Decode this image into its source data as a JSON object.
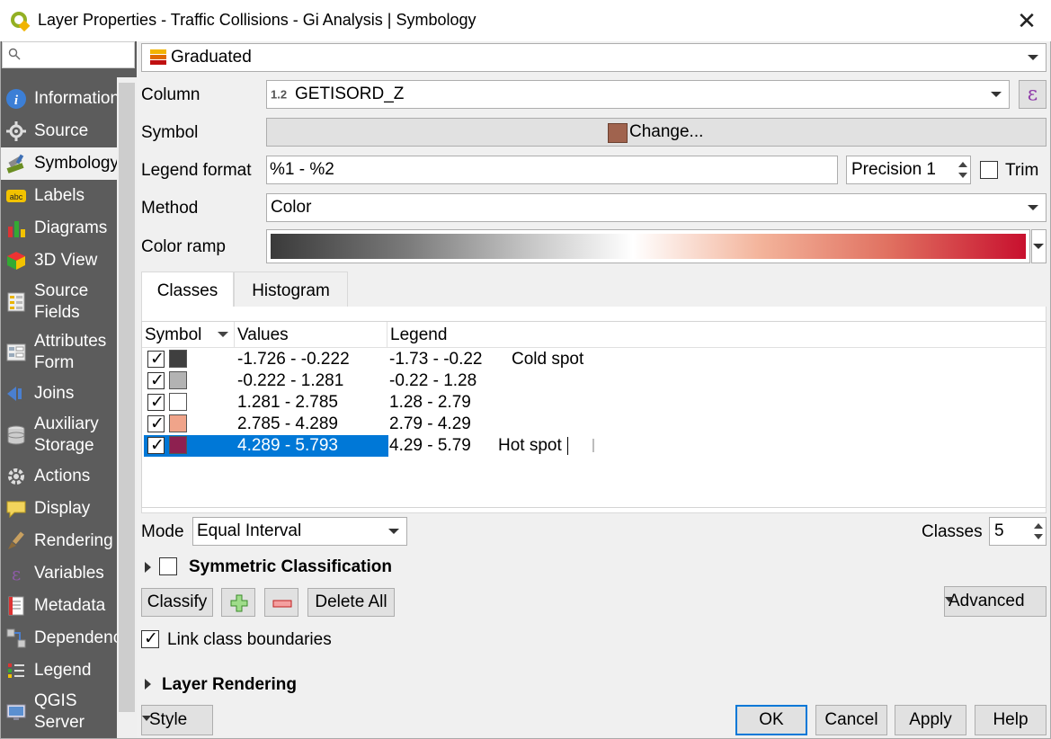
{
  "window": {
    "title": "Layer Properties - Traffic Collisions - Gi Analysis | Symbology"
  },
  "sidebar": {
    "search_placeholder": "",
    "items": [
      {
        "label": "Information",
        "icon": "info-icon"
      },
      {
        "label": "Source",
        "icon": "source-icon"
      },
      {
        "label": "Symbology",
        "icon": "symbology-icon",
        "selected": true
      },
      {
        "label": "Labels",
        "icon": "labels-icon"
      },
      {
        "label": "Diagrams",
        "icon": "diagrams-icon"
      },
      {
        "label": "3D View",
        "icon": "3d-view-icon"
      },
      {
        "label": "Source",
        "label2": "Fields",
        "icon": "source-fields-icon"
      },
      {
        "label": "Attributes",
        "label2": "Form",
        "icon": "attributes-form-icon"
      },
      {
        "label": "Joins",
        "icon": "joins-icon"
      },
      {
        "label": "Auxiliary",
        "label2": "Storage",
        "icon": "auxiliary-storage-icon"
      },
      {
        "label": "Actions",
        "icon": "actions-icon"
      },
      {
        "label": "Display",
        "icon": "display-icon"
      },
      {
        "label": "Rendering",
        "icon": "rendering-icon"
      },
      {
        "label": "Variables",
        "icon": "variables-icon"
      },
      {
        "label": "Metadata",
        "icon": "metadata-icon"
      },
      {
        "label": "Dependencies",
        "icon": "dependencies-icon"
      },
      {
        "label": "Legend",
        "icon": "legend-icon"
      },
      {
        "label": "QGIS",
        "label2": "Server",
        "icon": "qgis-server-icon"
      }
    ]
  },
  "renderer": {
    "value": "Graduated"
  },
  "column": {
    "label": "Column",
    "type_badge": "1.2",
    "value": "GETISORD_Z"
  },
  "symbol": {
    "label": "Symbol",
    "button": "Change...",
    "color": "#a0634e"
  },
  "legend_format": {
    "label": "Legend format",
    "value": "%1 - %2",
    "precision_label": "Precision 1",
    "trim_label": "Trim"
  },
  "method": {
    "label": "Method",
    "value": "Color"
  },
  "color_ramp": {
    "label": "Color ramp",
    "stops": [
      "#3a3a3a",
      "#7a7a7a",
      "#c9c9c9",
      "#ffffff",
      "#f3b39a",
      "#e07060",
      "#c8102e"
    ]
  },
  "tabs": [
    {
      "label": "Classes",
      "active": true
    },
    {
      "label": "Histogram"
    }
  ],
  "table": {
    "headers": {
      "symbol": "Symbol",
      "values": "Values",
      "legend": "Legend"
    },
    "rows": [
      {
        "values": "-1.726 - -0.222",
        "legend": "-1.73 - -0.22",
        "label": "Cold spot",
        "color": "#3f3f3f"
      },
      {
        "values": "-0.222 - 1.281",
        "legend": "-0.22 - 1.28",
        "label": "",
        "color": "#b3b3b3"
      },
      {
        "values": "1.281 - 2.785",
        "legend": "1.28 - 2.79",
        "label": "",
        "color": "#ffffff"
      },
      {
        "values": "2.785 - 4.289",
        "legend": "2.79 - 4.29",
        "label": "",
        "color": "#f0a48a"
      },
      {
        "values": "4.289 - 5.793",
        "legend": "4.29 - 5.79",
        "label": "Hot spot",
        "color": "#8e2050",
        "selected": true
      }
    ]
  },
  "mode": {
    "label": "Mode",
    "value": "Equal Interval"
  },
  "classes": {
    "label": "Classes",
    "value": "5"
  },
  "symmetric": {
    "label": "Symmetric Classification"
  },
  "buttons": {
    "classify": "Classify",
    "delete_all": "Delete All",
    "advanced": "Advanced"
  },
  "link_boundaries": {
    "label": "Link class boundaries",
    "checked": true
  },
  "layer_rendering": {
    "label": "Layer Rendering"
  },
  "footer": {
    "style": "Style",
    "ok": "OK",
    "cancel": "Cancel",
    "apply": "Apply",
    "help": "Help"
  }
}
